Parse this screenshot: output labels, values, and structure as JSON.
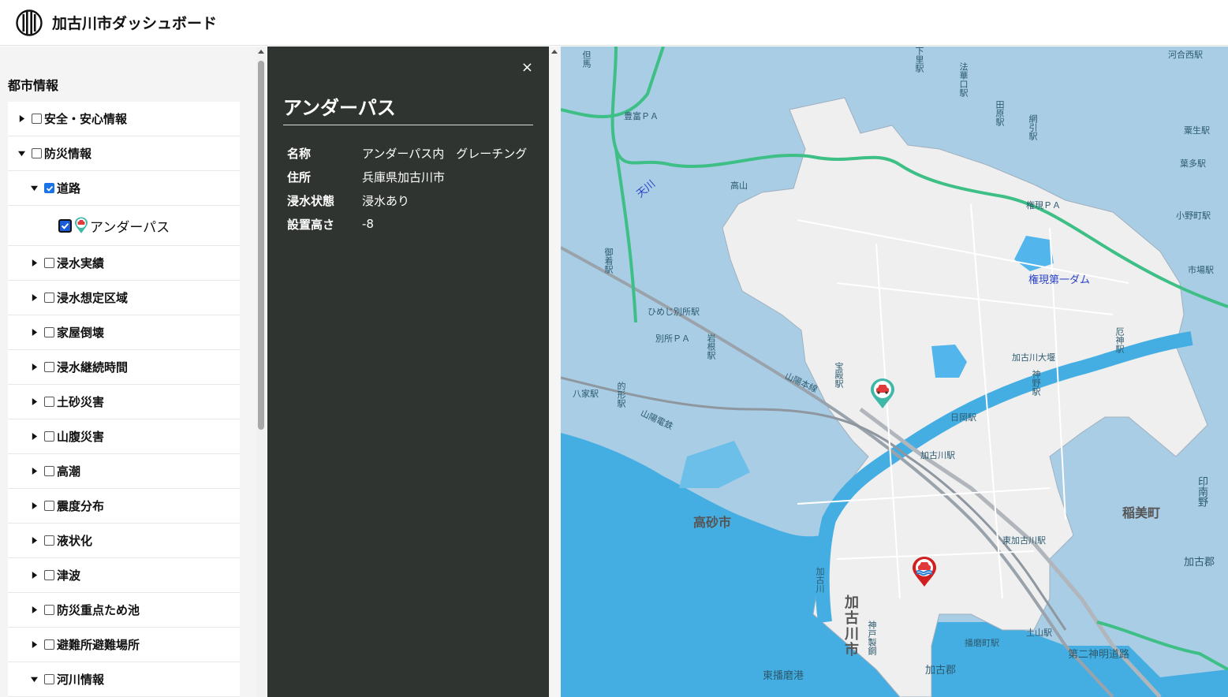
{
  "header": {
    "title": "加古川市ダッシュボード"
  },
  "sidebar": {
    "heading": "都市情報",
    "items": [
      {
        "label": "安全・安心情報",
        "checked": false,
        "expanded": false
      },
      {
        "label": "防災情報",
        "checked": false,
        "expanded": true
      },
      {
        "label": "道路",
        "checked": true,
        "expanded": true
      },
      {
        "label": "アンダーパス",
        "checked": true
      },
      {
        "label": "浸水実績",
        "checked": false,
        "expanded": false
      },
      {
        "label": "浸水想定区域",
        "checked": false,
        "expanded": false
      },
      {
        "label": "家屋倒壊",
        "checked": false,
        "expanded": false
      },
      {
        "label": "浸水継続時間",
        "checked": false,
        "expanded": false
      },
      {
        "label": "土砂災害",
        "checked": false,
        "expanded": false
      },
      {
        "label": "山腹災害",
        "checked": false,
        "expanded": false
      },
      {
        "label": "高潮",
        "checked": false,
        "expanded": false
      },
      {
        "label": "震度分布",
        "checked": false,
        "expanded": false
      },
      {
        "label": "液状化",
        "checked": false,
        "expanded": false
      },
      {
        "label": "津波",
        "checked": false,
        "expanded": false
      },
      {
        "label": "防災重点ため池",
        "checked": false,
        "expanded": false
      },
      {
        "label": "避難所避難場所",
        "checked": false,
        "expanded": false
      },
      {
        "label": "河川情報",
        "checked": false,
        "expanded": true
      }
    ]
  },
  "panel": {
    "close": "×",
    "title": "アンダーパス",
    "fields": [
      {
        "key": "名称",
        "value": "アンダーパス内　グレーチング"
      },
      {
        "key": "住所",
        "value": "兵庫県加古川市"
      },
      {
        "key": "浸水状態",
        "value": "浸水あり"
      },
      {
        "key": "設置高さ",
        "value": "-8"
      }
    ]
  },
  "map": {
    "labels": {
      "tenkawa": "天川",
      "takayama": "高山",
      "hoshinoki_pa": "豊富ＰＡ",
      "gongen_pa": "権現ＰＡ",
      "gongen_dam": "権現第一ダム",
      "himeji_bessho": "ひめじ別所駅",
      "bessho_pa": "別所ＰＡ",
      "kakogawa_ozeki": "加古川大堰",
      "sanyo_honsen": "山陽本線",
      "sanyo_dentetsu": "山陽電鉄",
      "yaie_eki": "八家駅",
      "hioka_eki": "日岡駅",
      "kakogawa_eki": "加古川駅",
      "takasago": "高砂市",
      "inami": "稲美町",
      "higashi_kakogawa": "東加古川駅",
      "kako_gun_1": "加古郡",
      "kako_gun_2": "加古郡",
      "higashi_harima": "東播磨港",
      "daini_shinmei": "第二神明道路",
      "tsuchiyama": "土山駅",
      "harima": "播磨町駅",
      "kakogawa_city": "加古川市",
      "kakogawa_river": "加古川",
      "kobe_steel": "神戸製鋼",
      "kawaichi": "河合西駅",
      "awao": "粟生駅",
      "hatada": "葉多駅",
      "onomachi": "小野町駅",
      "ichibamachi": "市場駅",
      "shimonotsubo": "下里駅",
      "hokke": "法華口駅",
      "tahara": "田原駅",
      "amikobiki": "網引駅",
      "ono": "小野駅",
      "mikuri": "御着駅",
      "kaminoki": "神野駅",
      "takarazeki": "宝殿駅",
      "iwakami": "岩根駅",
      "kaminoe": "厄神駅",
      "inami_no": "印南野",
      "matogata": "的形駅",
      "hitoyama": "但馬"
    }
  }
}
